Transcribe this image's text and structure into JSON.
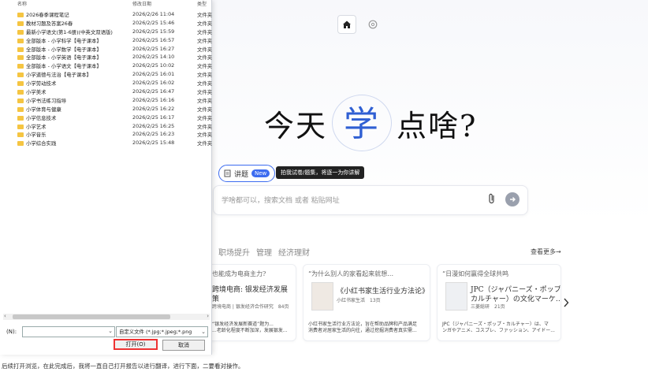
{
  "dialog": {
    "headers": {
      "name": "名称",
      "date": "修改日期",
      "type": "类型"
    },
    "rows": [
      {
        "name": "2026春季课程笔记",
        "date": "2026/2/26 11:04",
        "type": "文件夹"
      },
      {
        "name": "教材习题及答案26春",
        "date": "2026/2/25 15:46",
        "type": "文件夹"
      },
      {
        "name": "最新小学语文(第1-6册)(中英文双语版)",
        "date": "2026/2/25 15:59",
        "type": "文件夹"
      },
      {
        "name": "全部版本 - 小学科学【电子课本】",
        "date": "2026/2/25 16:57",
        "type": "文件夹"
      },
      {
        "name": "全部版本 - 小学数学【电子课本】",
        "date": "2026/2/25 16:27",
        "type": "文件夹"
      },
      {
        "name": "全部版本 - 小学英语【电子课本】",
        "date": "2026/2/25 14:10",
        "type": "文件夹"
      },
      {
        "name": "全部版本 - 小学语文【电子课本】",
        "date": "2026/2/25 10:02",
        "type": "文件夹"
      },
      {
        "name": "小学道德与法治【电子课本】",
        "date": "2026/2/25 16:01",
        "type": "文件夹"
      },
      {
        "name": "小学劳动技术",
        "date": "2026/2/25 16:02",
        "type": "文件夹"
      },
      {
        "name": "小学美术",
        "date": "2026/2/25 16:47",
        "type": "文件夹"
      },
      {
        "name": "小学书法练习指导",
        "date": "2026/2/25 16:16",
        "type": "文件夹"
      },
      {
        "name": "小学体育与健康",
        "date": "2026/2/25 16:22",
        "type": "文件夹"
      },
      {
        "name": "小学信息技术",
        "date": "2026/2/25 16:17",
        "type": "文件夹"
      },
      {
        "name": "小学艺术",
        "date": "2026/2/25 16:25",
        "type": "文件夹"
      },
      {
        "name": "小学音乐",
        "date": "2026/2/25 16:23",
        "type": "文件夹"
      },
      {
        "name": "小学综合实践",
        "date": "2026/2/25 15:48",
        "type": "文件夹"
      }
    ],
    "filename_label": "(N):",
    "filename_value": "",
    "filetype_value": "自定义文件 (*.jpg;*.jpeg;*.png",
    "open_button": "打开(O)",
    "cancel_button": "取消"
  },
  "page": {
    "hero_before": "今天",
    "hero_highlight": "学",
    "hero_after": "点啥?",
    "chip_label": "讲题",
    "chip_badge": "New",
    "tooltip": "拍我试卷/题集，将逐一为你讲解",
    "search_placeholder": "学啥都可以，搜索文档 或者 粘贴网址",
    "categories": [
      "职场提升",
      "管理",
      "经济理财"
    ],
    "more_link": "查看更多→",
    "cards": [
      {
        "title": "也能成为电商主力?",
        "book_title": "跨境电商: 银发经济发展",
        "book_title2": "策",
        "meta": "跨境电商 | 银发经济合作研究　84页",
        "desc1": "“银发经济发展新赛道”题为...",
        "desc2": "...老龄化程度不断加深，发展银发..."
      },
      {
        "title": "“为什么别人的家看起来就想…",
        "book_title": "《小红书家生活行业方法论》",
        "meta": "小红书家生活　13页",
        "desc1": "小红书家生活行业方法论，旨在帮助品牌和产品满足",
        "desc2": "消费者对居家生活的向往，通过挖掘消费者真实需..."
      },
      {
        "title": "“日漫如何赢得全球共鸣",
        "book_title": "JPC（ジャパニーズ・ポップ",
        "book_title2": "カルチャー）の文化マーケ…",
        "meta": "三菱総研　21页",
        "desc1": "JPC（ジャパニーズ・ポップ・カルチャー）は、マ",
        "desc2": "ンガやアニメ、コスプレ、ファッション、アイドー..."
      }
    ]
  },
  "footer_text": "后续打开浏览，在此完成后，我将一直自己打开报告以进行翻译，进行下面，二要看对操作。"
}
